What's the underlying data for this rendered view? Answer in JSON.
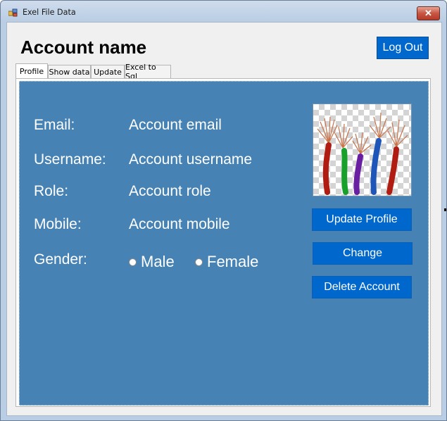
{
  "window": {
    "title": "Exel File Data",
    "close_glyph": "✕"
  },
  "header": {
    "account_name": "Account name",
    "logout_label": "Log Out"
  },
  "tabs": [
    {
      "label": "Profile",
      "active": true
    },
    {
      "label": "Show data",
      "active": false
    },
    {
      "label": "Update",
      "active": false
    },
    {
      "label": "Excel to Sql",
      "active": false
    }
  ],
  "profile": {
    "background": "#4682b4",
    "fields": [
      {
        "label": "Email:",
        "value": "Account email"
      },
      {
        "label": "Username:",
        "value": "Account username"
      },
      {
        "label": "Role:",
        "value": "Account role"
      },
      {
        "label": "Mobile:",
        "value": "Account mobile"
      }
    ],
    "gender": {
      "label": "Gender:",
      "options": [
        {
          "label": "Male",
          "selected": false
        },
        {
          "label": "Female",
          "selected": false
        }
      ]
    },
    "picture_icon": "colored-wires-image",
    "buttons": {
      "update_profile": "Update Profile",
      "change": "Change",
      "delete_account": "Delete Account"
    }
  },
  "colors": {
    "accent_button": "#0068cc",
    "panel": "#4682b4"
  }
}
